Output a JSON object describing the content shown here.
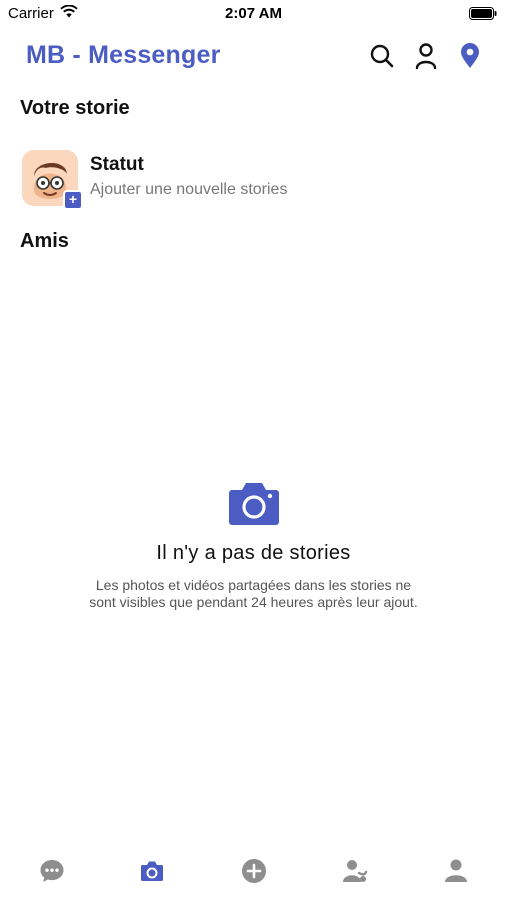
{
  "status_bar": {
    "carrier": "Carrier",
    "time": "2:07 AM"
  },
  "header": {
    "title": "MB - Messenger",
    "icons": [
      "search-icon",
      "person-icon",
      "location-pin-icon"
    ],
    "accent": "#4b5dc2"
  },
  "sections": {
    "my_story": "Votre storie",
    "friends": "Amis"
  },
  "my_story": {
    "title": "Statut",
    "subtitle": "Ajouter une nouvelle stories",
    "plus": "+"
  },
  "empty_state": {
    "icon": "camera-icon",
    "title": "Il n'y a pas de stories",
    "description": "Les photos et vidéos partagées dans les stories ne sont visibles que pendant 24 heures après leur ajout."
  },
  "tabbar": {
    "tabs": [
      {
        "icon": "chat-icon",
        "active": false
      },
      {
        "icon": "camera-icon",
        "active": true
      },
      {
        "icon": "add-icon",
        "active": false
      },
      {
        "icon": "contacts-icon",
        "active": false
      },
      {
        "icon": "profile-icon",
        "active": false
      }
    ],
    "active_color": "#4b5dc2",
    "inactive_color": "#8e8e8e"
  }
}
